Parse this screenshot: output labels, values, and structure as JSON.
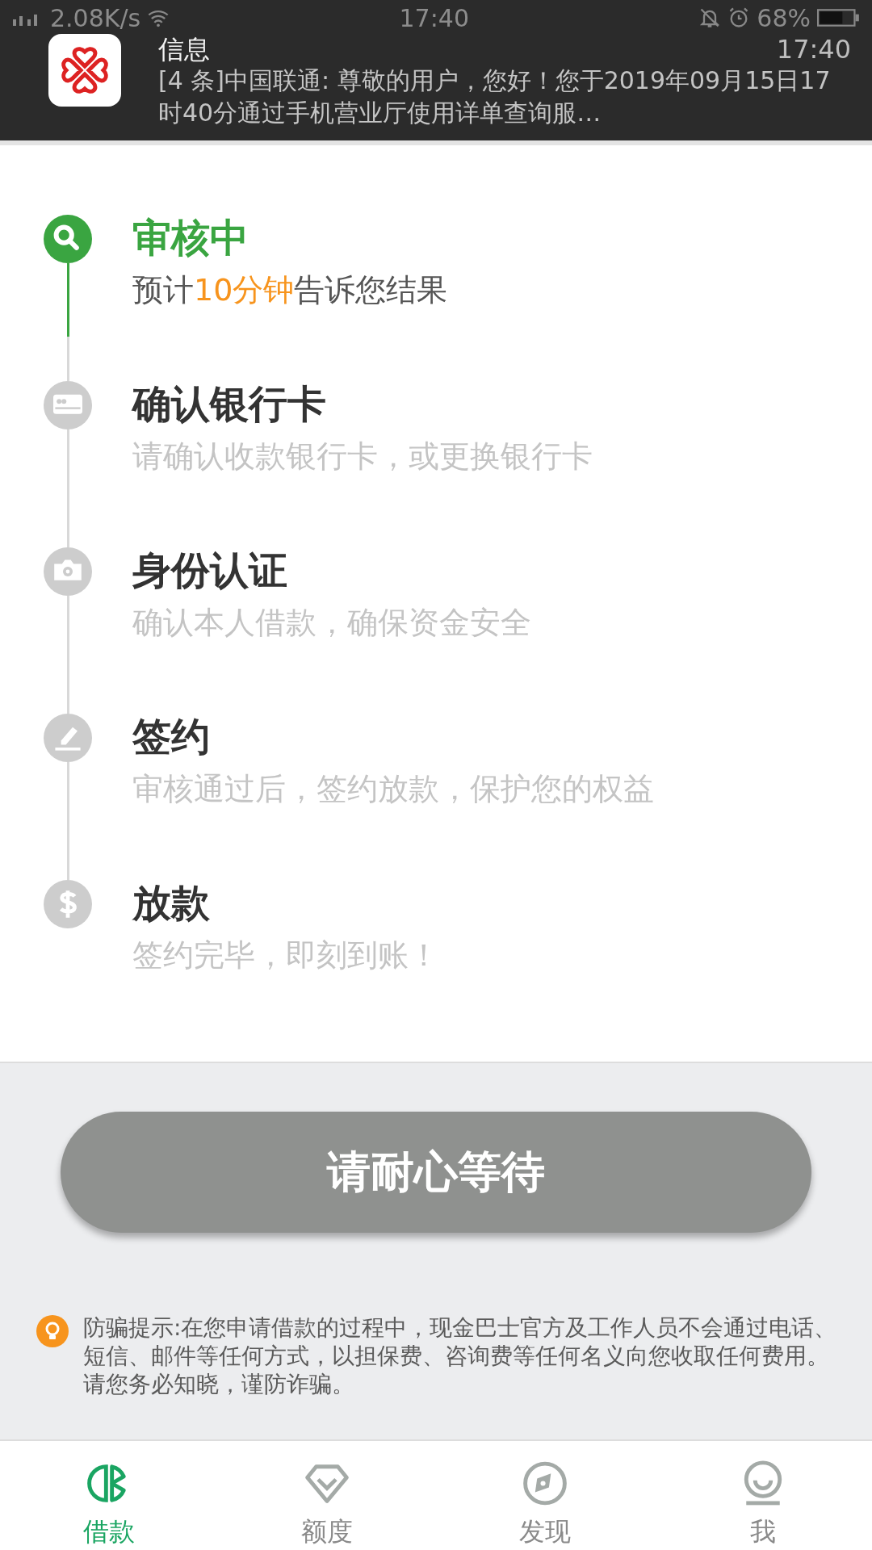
{
  "status_bar": {
    "network_speed": "2.08K/s",
    "time": "17:40",
    "battery": "68%"
  },
  "notification": {
    "app": "信息",
    "time": "17:40",
    "message": "[4 条]中国联通: 尊敬的用户，您好！您于2019年09月15日17时40分通过手机营业厅使用详单查询服…"
  },
  "steps": [
    {
      "kind": "search",
      "active": true,
      "title": "审核中",
      "subtitle": [
        {
          "text": "预计",
          "highlight": false
        },
        {
          "text": "10分钟",
          "highlight": true
        },
        {
          "text": "告诉您结果",
          "highlight": false
        }
      ]
    },
    {
      "kind": "card",
      "active": false,
      "title": "确认银行卡",
      "subtitle": [
        {
          "text": "请确认收款银行卡，或更换银行卡",
          "highlight": false
        }
      ]
    },
    {
      "kind": "camera",
      "active": false,
      "title": "身份认证",
      "subtitle": [
        {
          "text": "确认本人借款，确保资金安全",
          "highlight": false
        }
      ]
    },
    {
      "kind": "sign",
      "active": false,
      "title": "签约",
      "subtitle": [
        {
          "text": "审核通过后，签约放款，保护您的权益",
          "highlight": false
        }
      ]
    },
    {
      "kind": "dollar",
      "active": false,
      "title": "放款",
      "subtitle": [
        {
          "text": "签约完毕，即刻到账！",
          "highlight": false
        }
      ]
    }
  ],
  "wait_button": {
    "label": "请耐心等待",
    "disabled": true
  },
  "tip": "防骗提示:在您申请借款的过程中，现金巴士官方及工作人员不会通过电话、短信、邮件等任何方式，以担保费、咨询费等任何名义向您收取任何费用。请您务必知晓，谨防诈骗。",
  "nav": [
    {
      "kind": "loan",
      "label": "借款",
      "selected": true
    },
    {
      "kind": "quota",
      "label": "额度",
      "selected": false
    },
    {
      "kind": "discover",
      "label": "发现",
      "selected": false
    },
    {
      "kind": "me",
      "label": "我",
      "selected": false
    }
  ]
}
